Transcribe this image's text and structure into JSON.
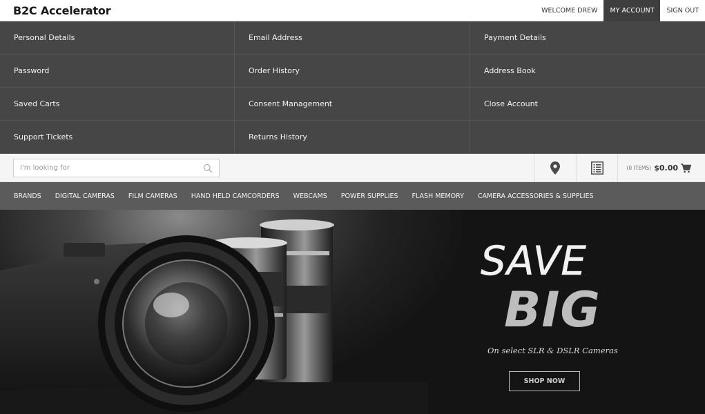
{
  "header": {
    "logo": "B2C Accelerator",
    "links": [
      "WELCOME DREW",
      "MY ACCOUNT",
      "SIGN OUT"
    ]
  },
  "account_menu": {
    "items": [
      "Personal Details",
      "Email Address",
      "Payment Details",
      "Password",
      "Order History",
      "Address Book",
      "Saved Carts",
      "Consent Management",
      "Close Account",
      "Support Tickets",
      "Returns History",
      ""
    ]
  },
  "search": {
    "placeholder": "I'm looking for",
    "value": ""
  },
  "toolbar": {
    "store_finder_icon": "map-pin-icon",
    "quick_order_icon": "list-icon"
  },
  "cart": {
    "items": "(0 ITEMS)",
    "total": "$0.00",
    "icon": "cart-icon"
  },
  "categories": [
    "BRANDS",
    "DIGITAL CAMERAS",
    "FILM CAMERAS",
    "HAND HELD CAMCORDERS",
    "WEBCAMS",
    "POWER SUPPLIES",
    "FLASH MEMORY",
    "CAMERA ACCESSORIES & SUPPLIES"
  ],
  "hero": {
    "headline": "SAVE",
    "subheadline": "BIG",
    "tagline": "On select SLR & DSLR Cameras",
    "cta": "SHOP NOW"
  }
}
